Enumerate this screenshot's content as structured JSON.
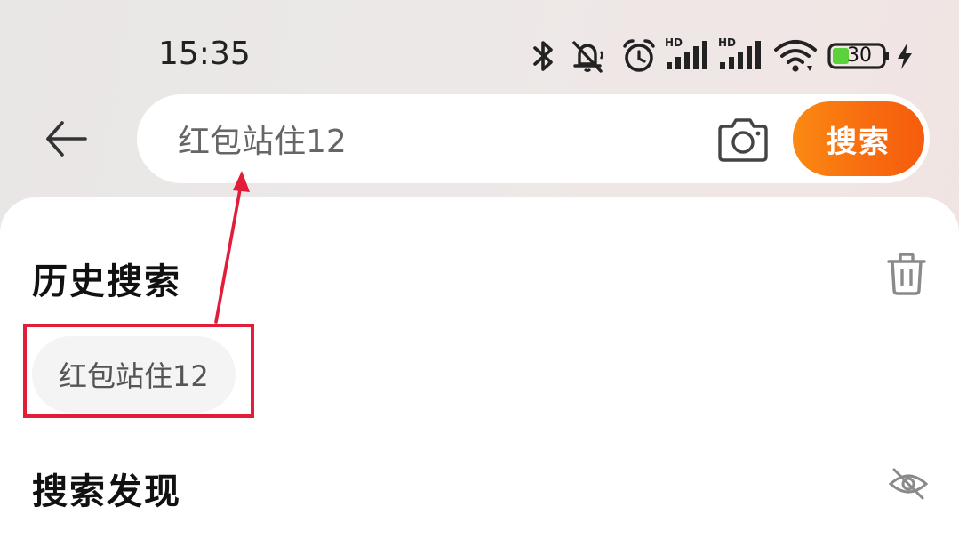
{
  "status_bar": {
    "time": "15:35",
    "battery_level": "30",
    "icons": [
      "bluetooth-icon",
      "mute-icon",
      "alarm-icon",
      "signal-hd-icon",
      "signal-hd-icon",
      "wifi-icon",
      "battery-icon",
      "charging-icon"
    ],
    "signal_badge": "HD"
  },
  "search": {
    "query": "红包站住12",
    "button_label": "搜索"
  },
  "history": {
    "title": "历史搜索",
    "items": [
      {
        "label": "红包站住12"
      }
    ]
  },
  "discover": {
    "title": "搜索发现"
  },
  "colors": {
    "accent_orange": "#f86a10",
    "annotation_red": "#e11d3a",
    "battery_green": "#5bd13a"
  }
}
